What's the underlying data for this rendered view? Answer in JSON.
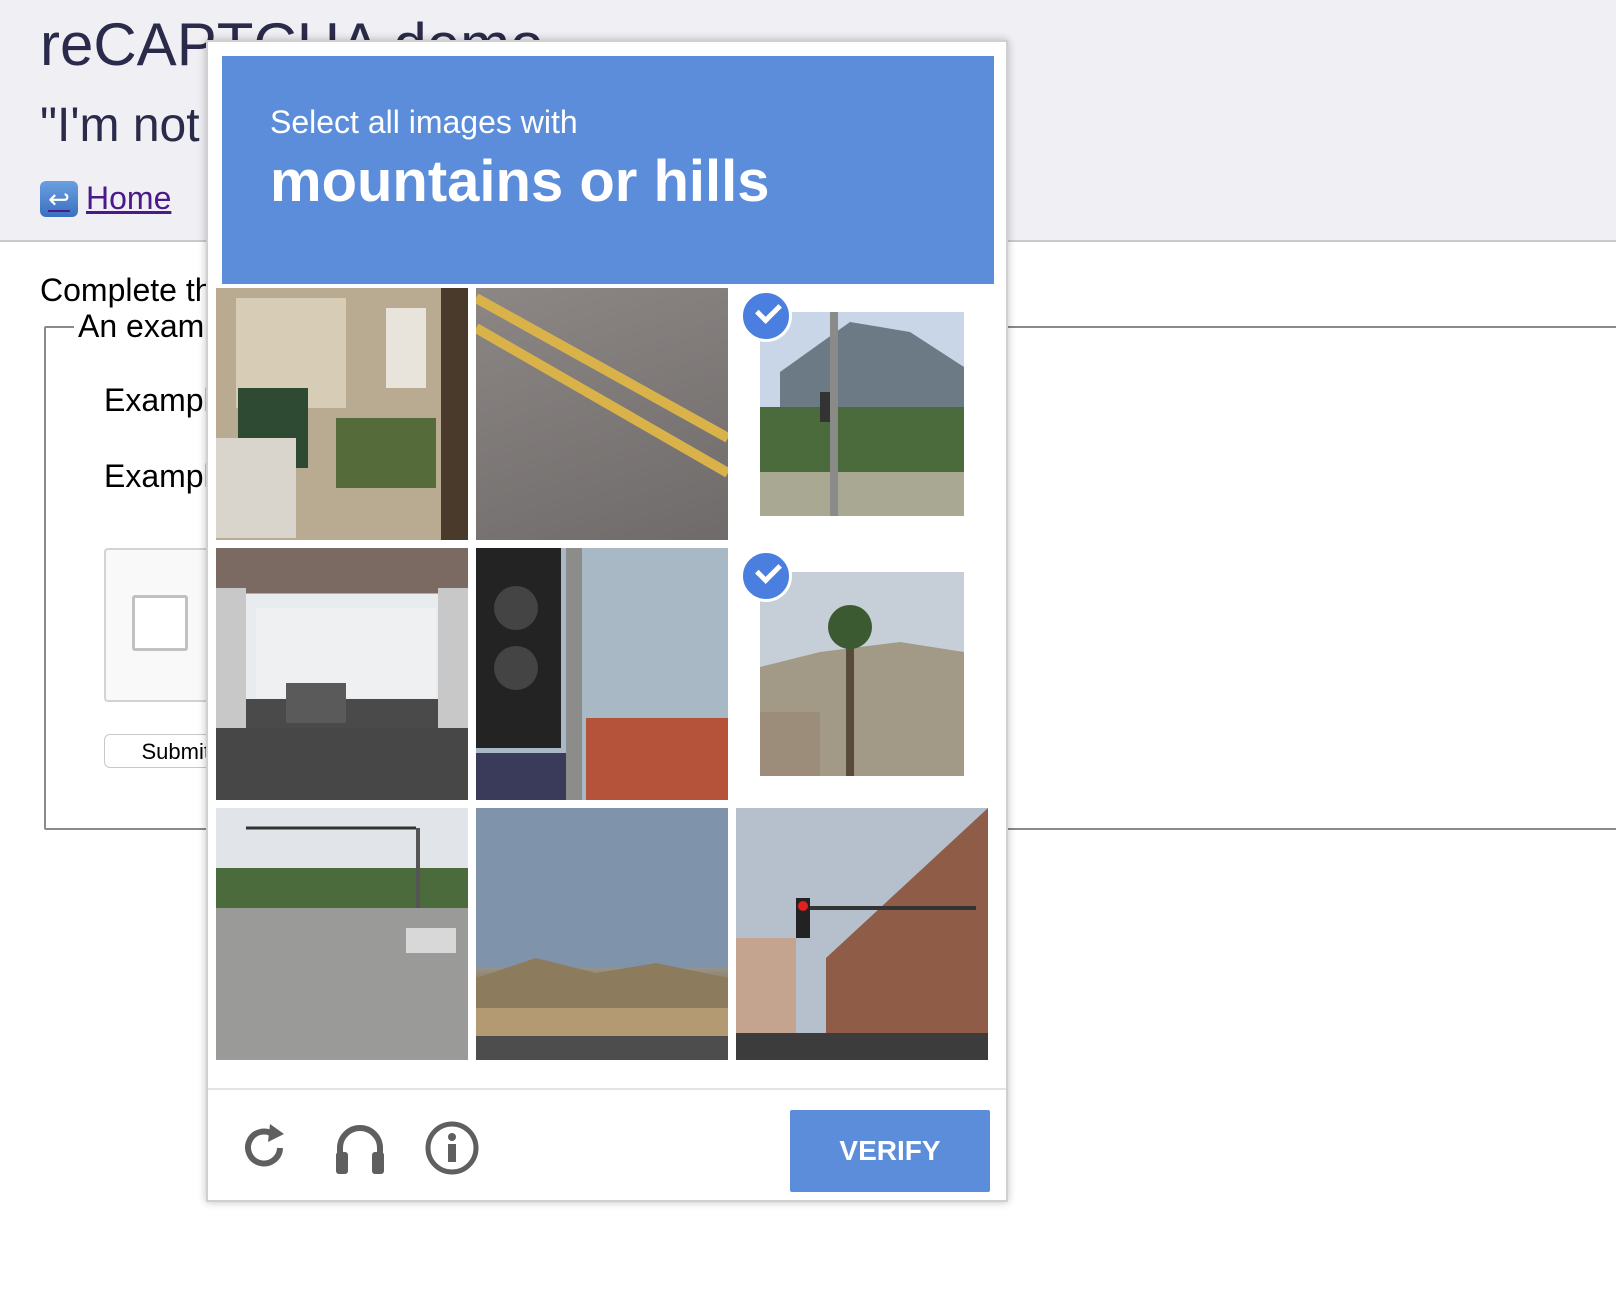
{
  "page": {
    "title": "reCAPTCHA demo",
    "subtitle": "\"I'm not",
    "home_link": "Home",
    "instructions": "Complete th",
    "legend": "An examp",
    "example_label_1": "Exampl",
    "example_label_2": "Exampl",
    "submit_label": "Submit ↵"
  },
  "challenge": {
    "prompt_line1": "Select all images with",
    "prompt_line2": "mountains or hills",
    "tiles": [
      {
        "name": "house-steps",
        "selected": false
      },
      {
        "name": "road-yellow-lines",
        "selected": false
      },
      {
        "name": "mountain-traffic-light",
        "selected": true
      },
      {
        "name": "highway-underpass",
        "selected": false
      },
      {
        "name": "traffic-signal-building",
        "selected": false
      },
      {
        "name": "palm-tree-hills",
        "selected": true
      },
      {
        "name": "street-with-cars",
        "selected": false
      },
      {
        "name": "sky-and-hills",
        "selected": false
      },
      {
        "name": "city-street-building",
        "selected": false
      }
    ],
    "footer": {
      "reload_icon": "reload-icon",
      "audio_icon": "headphones-icon",
      "info_icon": "info-icon",
      "verify_label": "VERIFY"
    }
  },
  "colors": {
    "accent": "#5b8ddb",
    "check": "#4a7fe0"
  }
}
